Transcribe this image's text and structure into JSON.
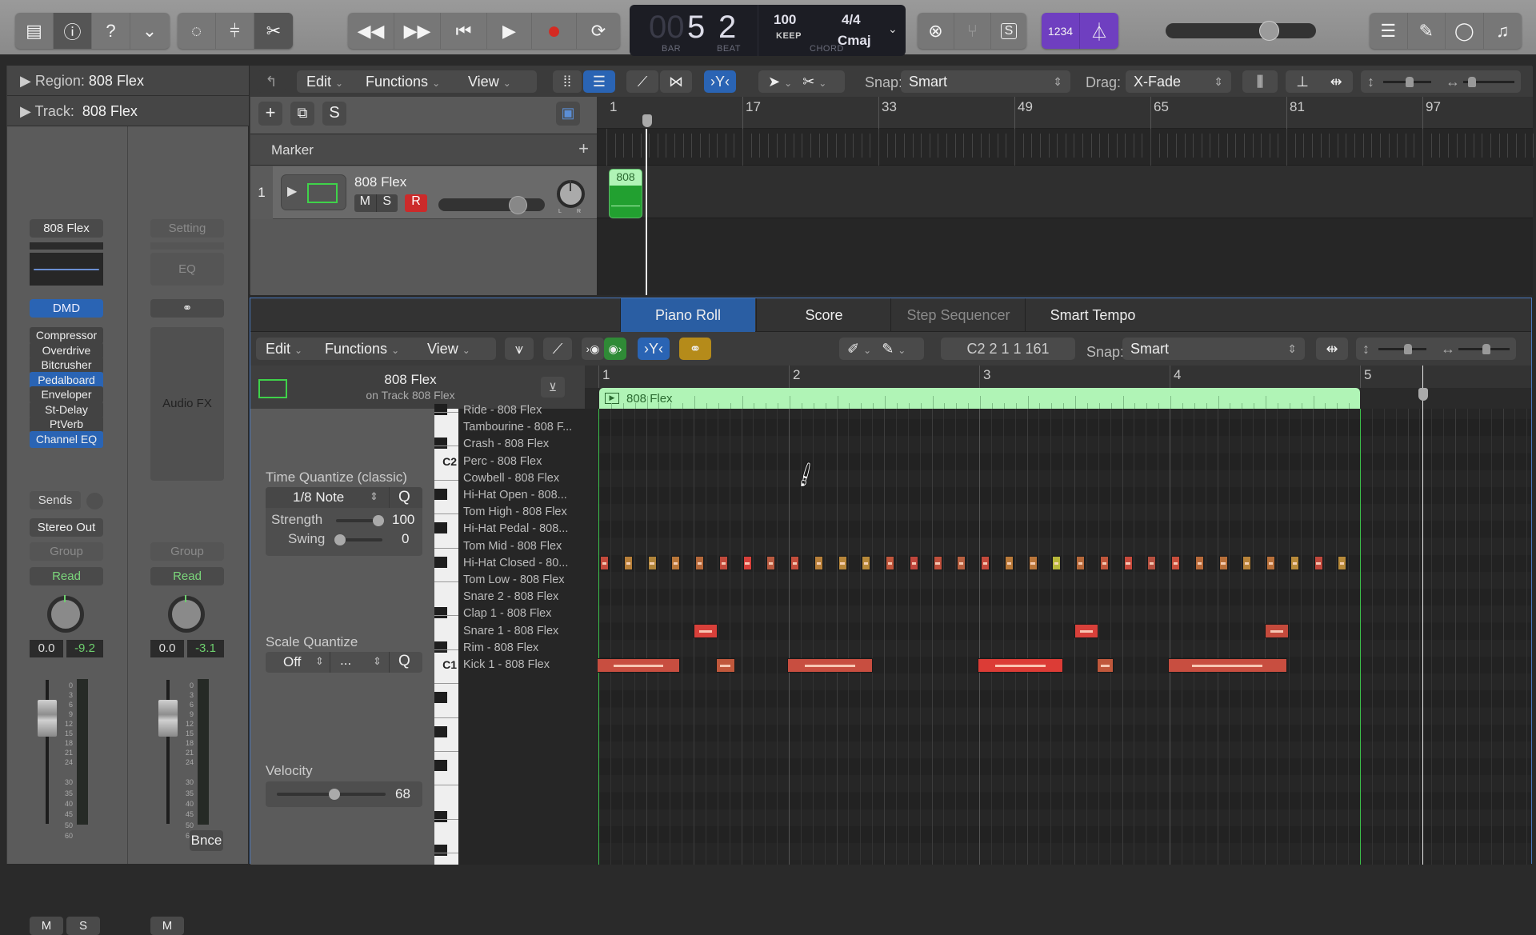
{
  "control_bar": {
    "view_buttons": [
      {
        "name": "library",
        "icon": "library-icon"
      },
      {
        "name": "inspector",
        "icon": "info-icon",
        "active": true
      },
      {
        "name": "quick-help",
        "icon": "help-icon"
      },
      {
        "name": "toolbar",
        "icon": "toolbar-icon"
      }
    ],
    "edit_buttons": [
      {
        "name": "smart-controls",
        "icon": "smart-controls-icon"
      },
      {
        "name": "mixer",
        "icon": "mixer-icon"
      },
      {
        "name": "editors",
        "icon": "scissors-icon",
        "active": true
      }
    ],
    "transport": [
      {
        "name": "rewind",
        "glyph": "◀◀"
      },
      {
        "name": "fast-forward",
        "glyph": "▶▶"
      },
      {
        "name": "go-to-beginning",
        "glyph": "⏮"
      },
      {
        "name": "play",
        "glyph": "▶"
      },
      {
        "name": "record",
        "glyph": "●"
      },
      {
        "name": "cycle",
        "glyph": "⟳"
      }
    ],
    "lcd": {
      "bar_dim": "00",
      "bar": "5",
      "beat": "2",
      "bar_label": "BAR",
      "beat_label": "BEAT",
      "tempo": "100",
      "tempo_label": "KEEP",
      "signature": "4/4",
      "key": "Cmaj",
      "chord_label": "CHORD"
    },
    "mode_buttons": [
      {
        "name": "replace",
        "icon": "replace-icon"
      },
      {
        "name": "tuner",
        "icon": "tuning-fork-icon"
      },
      {
        "name": "solo",
        "label": "S"
      }
    ],
    "count_in_label": "1234",
    "metronome_icon": "metronome-icon",
    "accent_color": "#6f3fc0",
    "master_volume": 0.72,
    "right_buttons": [
      {
        "name": "list-editors",
        "icon": "list-icon"
      },
      {
        "name": "note-pad",
        "icon": "notepad-icon"
      },
      {
        "name": "loop-browser",
        "icon": "loop-icon"
      },
      {
        "name": "media-browser",
        "icon": "media-icon"
      }
    ]
  },
  "inspector": {
    "region_label": "Region:",
    "region_value": "808 Flex",
    "track_label": "Track:",
    "track_value": "808 Flex",
    "strip1": {
      "setting": "808 Flex",
      "instrument": "DMD",
      "plugins": [
        {
          "label": "Compressor",
          "active": false
        },
        {
          "label": "Overdrive",
          "active": false
        },
        {
          "label": "Bitcrusher",
          "active": false
        },
        {
          "label": "Pedalboard",
          "active": true
        },
        {
          "label": "Enveloper",
          "active": false
        },
        {
          "label": "St-Delay",
          "active": false
        },
        {
          "label": "PtVerb",
          "active": false
        },
        {
          "label": "Channel EQ",
          "active": true
        }
      ],
      "sends": "Sends",
      "output": "Stereo Out",
      "group": "Group",
      "automation": "Read",
      "volume": "0.0",
      "peak": "-9.2",
      "mute": "M",
      "solo": "S"
    },
    "strip2": {
      "setting": "Setting",
      "eq": "EQ",
      "link_icon": "link-icon",
      "audio_fx": "Audio FX",
      "group": "Group",
      "automation": "Read",
      "volume": "0.0",
      "peak": "-3.1",
      "bounce": "Bnce",
      "mute": "M"
    },
    "meter_scale": [
      "0",
      "3",
      "6",
      "9",
      "12",
      "15",
      "18",
      "21",
      "24",
      "30",
      "35",
      "40",
      "45",
      "50",
      "60"
    ]
  },
  "tracks": {
    "toolbar": {
      "back_icon": "back-icon",
      "menus": [
        "Edit",
        "Functions",
        "View"
      ],
      "snap_label": "Snap:",
      "snap_value": "Smart",
      "drag_label": "Drag:",
      "drag_value": "X-Fade"
    },
    "header_buttons": {
      "add": "+",
      "duplicate": "duplicate-icon",
      "solo": "S"
    },
    "marker_label": "Marker",
    "ruler": [
      "1",
      "17",
      "33",
      "49",
      "65",
      "81",
      "97"
    ],
    "track": {
      "number": "1",
      "name": "808 Flex",
      "mute": "M",
      "solo": "S",
      "record": "R",
      "volume": 0.8,
      "pan_left": "L",
      "pan_right": "R",
      "region_label": "808"
    }
  },
  "editor": {
    "tabs": [
      {
        "label": "Piano Roll",
        "selected": true
      },
      {
        "label": "Score",
        "selected": false
      },
      {
        "label": "Step Sequencer",
        "selected": false,
        "dim": true
      },
      {
        "label": "Smart Tempo",
        "selected": false
      }
    ],
    "toolbar": {
      "menus": [
        "Edit",
        "Functions",
        "View"
      ],
      "position": "C2  2 1 1 161",
      "snap_label": "Snap:",
      "snap_value": "Smart"
    },
    "region_name": "808 Flex",
    "region_track": "on Track 808 Flex",
    "ruler": [
      "1",
      "2",
      "3",
      "4",
      "5"
    ],
    "time_quantize": {
      "title": "Time Quantize (classic)",
      "value": "1/8 Note",
      "q": "Q",
      "strength_label": "Strength",
      "strength": "100",
      "swing_label": "Swing",
      "swing": "0"
    },
    "scale_quantize": {
      "title": "Scale Quantize",
      "value": "Off",
      "scale": "...",
      "q": "Q"
    },
    "velocity": {
      "title": "Velocity",
      "value": "68"
    },
    "key_labels": {
      "c2": "C2",
      "c1": "C1"
    },
    "drum_names": [
      "Ride - 808 Flex",
      "Tambourine - 808 F...",
      "Crash - 808 Flex",
      "Perc - 808 Flex",
      "Cowbell - 808 Flex",
      "Hi-Hat Open - 808...",
      "Tom High - 808 Flex",
      "Hi-Hat Pedal - 808...",
      "Tom Mid - 808 Flex",
      "Hi-Hat Closed - 80...",
      "Tom Low - 808 Flex",
      "Snare 2 - 808 Flex",
      "Clap 1 - 808 Flex",
      "Snare 1 - 808 Flex",
      "Rim - 808 Flex",
      "Kick 1 - 808 Flex"
    ],
    "notes": {
      "hihat_closed_velocity_colors": [
        "#c44a3c",
        "#b8803a",
        "#b0843a",
        "#b9773a",
        "#b5683a",
        "#c04a3c",
        "#d8403a",
        "#b95a40",
        "#c44e3c",
        "#b8803a",
        "#b7863a",
        "#b88a3a",
        "#c0563c",
        "#c0463c",
        "#c0503c",
        "#b86040",
        "#c44a3c",
        "#ba7a3a",
        "#ba763a",
        "#b8b83a",
        "#b5683a",
        "#c0563c",
        "#c84a3c",
        "#b55040",
        "#c84e3c",
        "#b86a3a",
        "#b8703a",
        "#b8843a",
        "#b8703a",
        "#b88a3a",
        "#c0483c",
        "#b88a3a"
      ],
      "snare1": [
        {
          "start_beat": 2.0,
          "length_beats": 0.5,
          "color": "#d8403a"
        },
        {
          "start_beat": 10.0,
          "length_beats": 0.5,
          "color": "#d8403a"
        },
        {
          "start_beat": 14.0,
          "length_beats": 0.5,
          "color": "#c44a3c"
        }
      ],
      "kick1": [
        {
          "start_beat": 0.0,
          "length_beats": 1.75,
          "color": "#c84e40"
        },
        {
          "start_beat": 2.5,
          "length_beats": 0.4,
          "color": "#c0583c"
        },
        {
          "start_beat": 4.0,
          "length_beats": 1.8,
          "color": "#c84e40"
        },
        {
          "start_beat": 8.0,
          "length_beats": 1.8,
          "color": "#dc3c36"
        },
        {
          "start_beat": 10.5,
          "length_beats": 0.35,
          "color": "#c0583c"
        },
        {
          "start_beat": 12.0,
          "length_beats": 2.5,
          "color": "#c84e40"
        }
      ]
    }
  }
}
